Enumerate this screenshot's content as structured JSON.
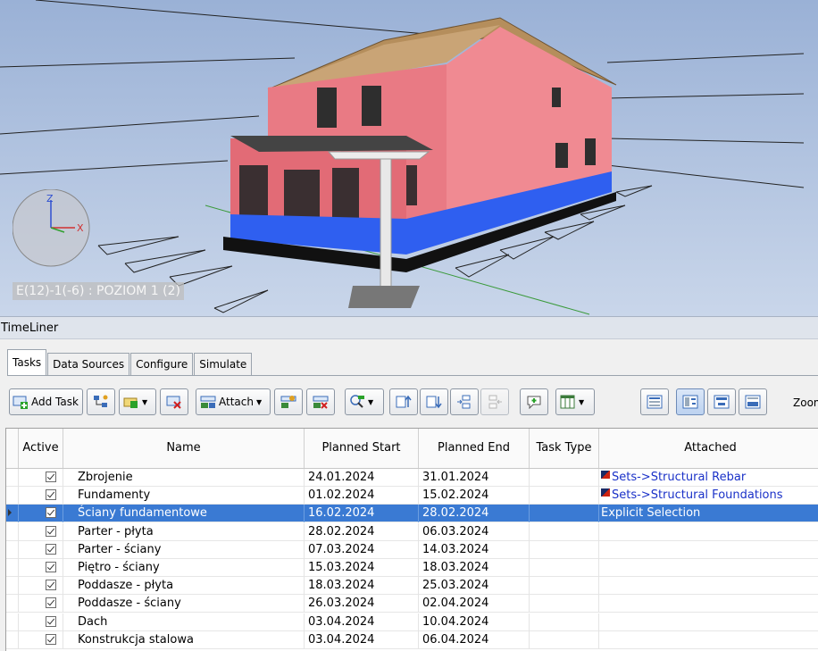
{
  "viewport": {
    "view_label": "E(12)-1(-6) : POZIOM 1 (2)",
    "axis_z": "Z",
    "axis_x": "X"
  },
  "panel": {
    "title": "TimeLiner"
  },
  "tabs": [
    {
      "label": "Tasks",
      "active": true
    },
    {
      "label": "Data Sources",
      "active": false
    },
    {
      "label": "Configure",
      "active": false
    },
    {
      "label": "Simulate",
      "active": false
    }
  ],
  "toolbar": {
    "add_task_label": "Add Task",
    "attach_label": "Attach",
    "zoom_label": "Zoom"
  },
  "grid": {
    "columns": [
      "Active",
      "Name",
      "Planned Start",
      "Planned End",
      "Task Type",
      "Attached"
    ],
    "rows": [
      {
        "name": "Zbrojenie",
        "start": "24.01.2024",
        "end": "31.01.2024",
        "type": "",
        "attached": "Sets->Structural Rebar",
        "selected": false
      },
      {
        "name": "Fundamenty",
        "start": "01.02.2024",
        "end": "15.02.2024",
        "type": "",
        "attached": "Sets->Structural Foundations",
        "selected": false
      },
      {
        "name": "Ściany fundamentowe",
        "start": "16.02.2024",
        "end": "28.02.2024",
        "type": "",
        "attached": "Explicit Selection",
        "selected": true
      },
      {
        "name": "Parter - płyta",
        "start": "28.02.2024",
        "end": "06.03.2024",
        "type": "",
        "attached": "",
        "selected": false
      },
      {
        "name": "Parter - ściany",
        "start": "07.03.2024",
        "end": "14.03.2024",
        "type": "",
        "attached": "",
        "selected": false
      },
      {
        "name": "Piętro - ściany",
        "start": "15.03.2024",
        "end": "18.03.2024",
        "type": "",
        "attached": "",
        "selected": false
      },
      {
        "name": "Poddasze - płyta",
        "start": "18.03.2024",
        "end": "25.03.2024",
        "type": "",
        "attached": "",
        "selected": false
      },
      {
        "name": "Poddasze - ściany",
        "start": "26.03.2024",
        "end": "02.04.2024",
        "type": "",
        "attached": "",
        "selected": false
      },
      {
        "name": "Dach",
        "start": "03.04.2024",
        "end": "10.04.2024",
        "type": "",
        "attached": "",
        "selected": false
      },
      {
        "name": "Konstrukcja stalowa",
        "start": "03.04.2024",
        "end": "06.04.2024",
        "type": "",
        "attached": "",
        "selected": false
      }
    ]
  },
  "colors": {
    "selection": "#3a7ad3",
    "wall": "#e97a84",
    "foundation": "#2f5ff0",
    "link": "#1a31c8"
  }
}
